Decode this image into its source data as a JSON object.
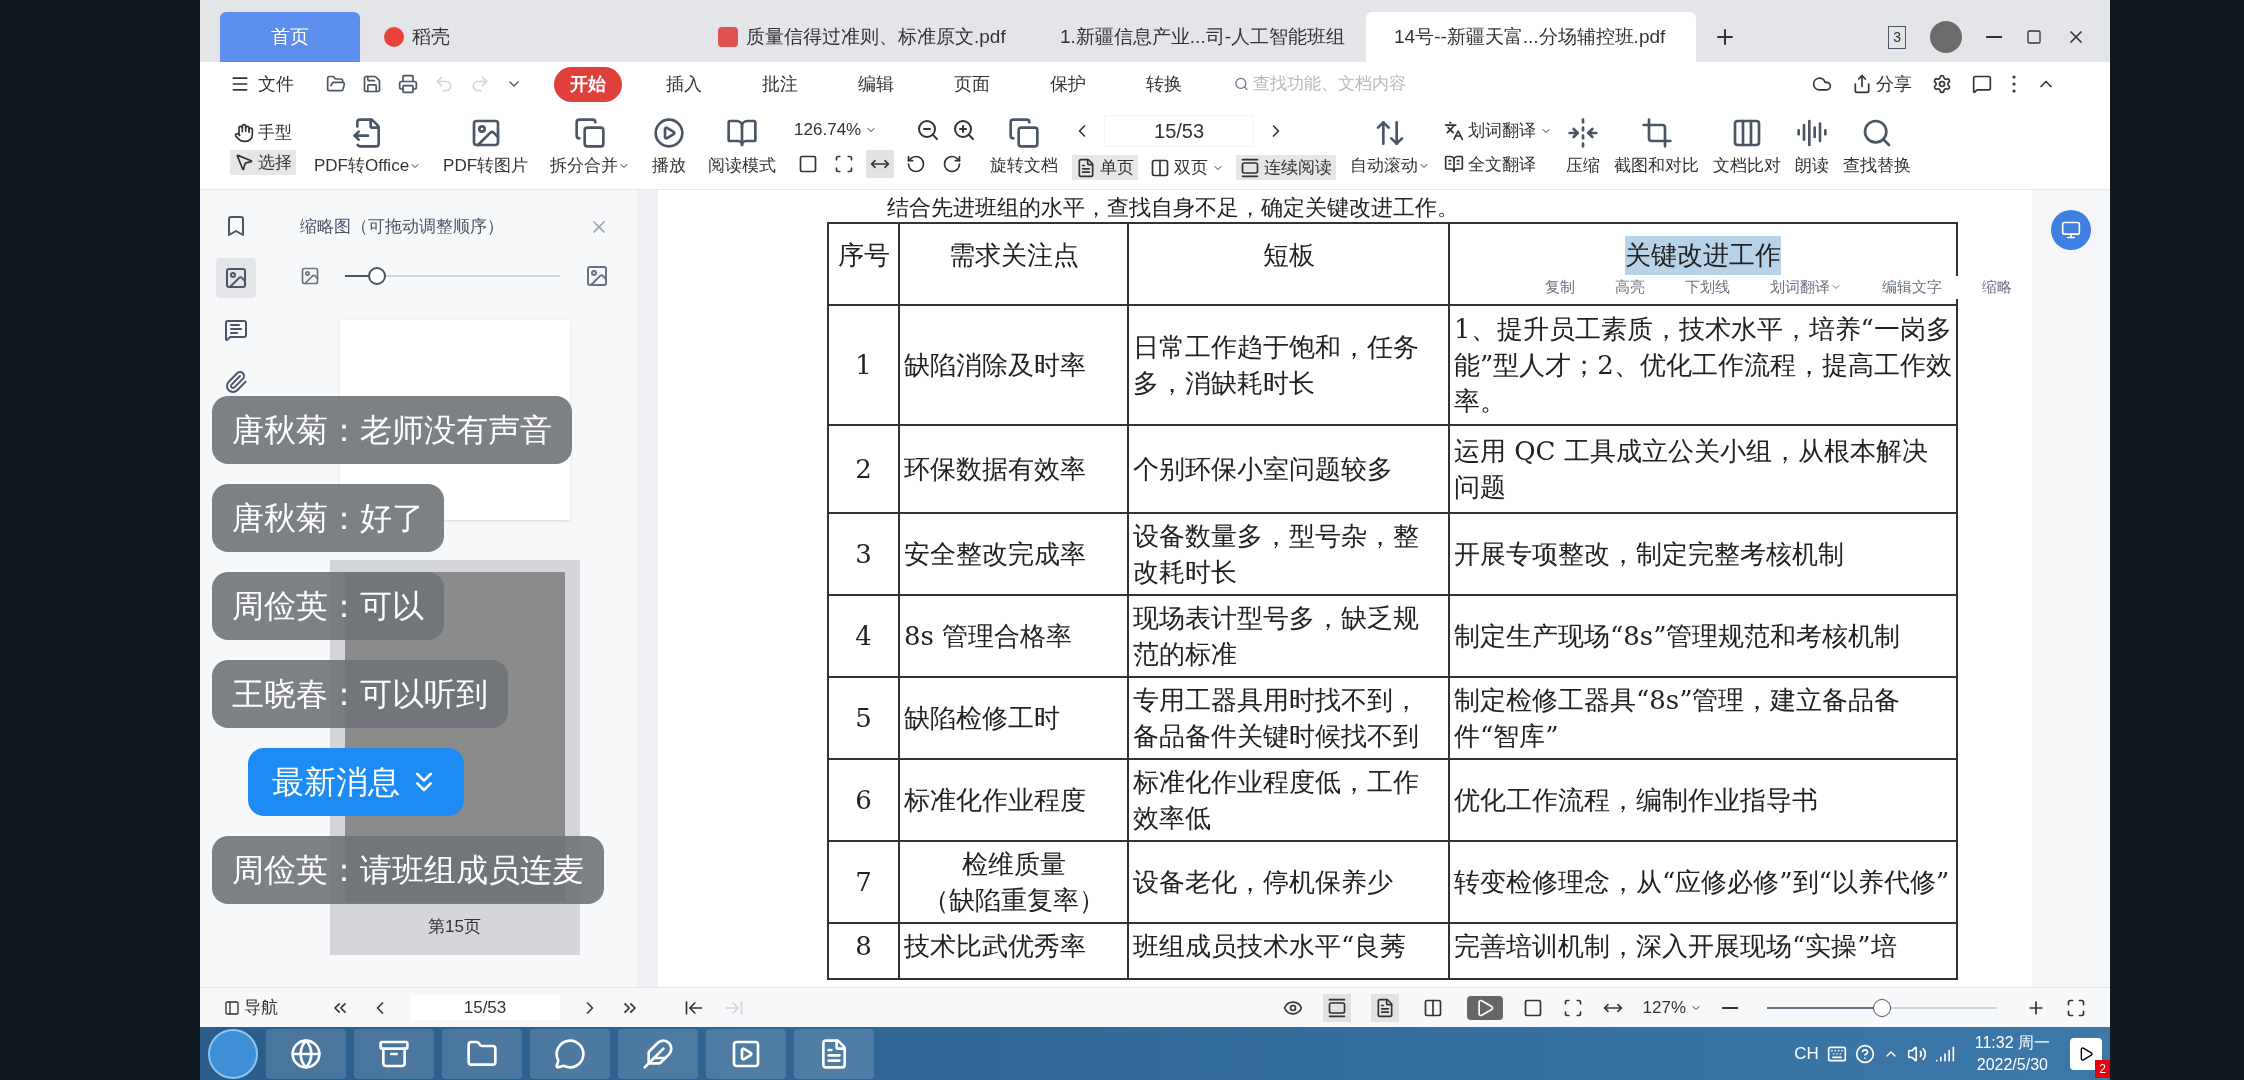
{
  "tabs": [
    {
      "label": "首页",
      "kind": "home",
      "selected": false
    },
    {
      "label": "稻壳",
      "kind": "docer",
      "selected": false
    },
    {
      "label": "质量信得过准则、标准原文.pdf",
      "kind": "pdf",
      "selected": false
    },
    {
      "label": "1.新疆信息产业...司-人工智能班组",
      "kind": "word",
      "selected": false
    },
    {
      "label": "14号--新疆天富...分场辅控班.pdf",
      "kind": "pdf",
      "selected": true
    }
  ],
  "window_badge": "3",
  "menu": {
    "file": "文件",
    "items": [
      {
        "label": "开始",
        "selected": true
      },
      {
        "label": "插入",
        "selected": false
      },
      {
        "label": "批注",
        "selected": false
      },
      {
        "label": "编辑",
        "selected": false
      },
      {
        "label": "页面",
        "selected": false
      },
      {
        "label": "保护",
        "selected": false
      },
      {
        "label": "转换",
        "selected": false
      }
    ],
    "search_placeholder": "查找功能、文档内容",
    "share": "分享"
  },
  "toolbar": {
    "pointer_modes": [
      {
        "label": "手型",
        "kind": "hand",
        "selected": false
      },
      {
        "label": "选择",
        "kind": "select",
        "selected": true
      }
    ],
    "tools": [
      {
        "label": "PDF转Office",
        "kind": "convert",
        "dropdown": true
      },
      {
        "label": "PDF转图片",
        "kind": "image",
        "dropdown": false
      },
      {
        "label": "拆分合并",
        "kind": "split",
        "dropdown": true
      },
      {
        "label": "播放",
        "kind": "play",
        "dropdown": false
      },
      {
        "label": "阅读模式",
        "kind": "read",
        "dropdown": false
      }
    ],
    "zoom": "126.74%",
    "fit_modes": [
      {
        "kind": "actual",
        "selected": false
      },
      {
        "kind": "fit",
        "selected": false
      },
      {
        "kind": "width",
        "selected": true
      },
      {
        "kind": "rotl",
        "selected": false
      },
      {
        "kind": "rotr",
        "selected": false
      }
    ],
    "rotate": "旋转文档",
    "page": "15/53",
    "view_modes": [
      {
        "label": "单页",
        "kind": "single",
        "selected": true,
        "dropdown": false
      },
      {
        "label": "双页",
        "kind": "double",
        "selected": false,
        "dropdown": true
      },
      {
        "label": "连续阅读",
        "kind": "continuous",
        "selected": true,
        "dropdown": false
      }
    ],
    "auto_scroll": "自动滚动",
    "translate": "划词翻译",
    "full_translate": "全文翻译",
    "tools2": [
      {
        "label": "压缩",
        "kind": "compress"
      },
      {
        "label": "截图和对比",
        "kind": "screenshot"
      },
      {
        "label": "文档比对",
        "kind": "compare"
      },
      {
        "label": "朗读",
        "kind": "read_aloud"
      },
      {
        "label": "查找替换",
        "kind": "find"
      }
    ]
  },
  "sidebar": {
    "title": "缩略图（可拖动调整顺序）",
    "level": 0.15,
    "icons": [
      {
        "kind": "bookmark",
        "selected": false
      },
      {
        "kind": "thumbnail",
        "selected": true
      },
      {
        "kind": "comment",
        "selected": false
      },
      {
        "kind": "attachment",
        "selected": false
      }
    ],
    "pages": [
      {
        "label": "第15页",
        "selected": true
      }
    ]
  },
  "chat": {
    "messages": [
      {
        "text": "唐秋菊：老师没有声音"
      },
      {
        "text": "唐秋菊：好了"
      },
      {
        "text": "周俭英：可以"
      },
      {
        "text": "王晓春：可以听到"
      },
      {
        "text": "周俭英：请班组成员连麦"
      }
    ],
    "latest_button": "最新消息"
  },
  "document": {
    "intro": "结合先进班组的水平，查找自身不足，确定关键改进工作。",
    "columns": [
      {
        "label": "序号",
        "selected": false
      },
      {
        "label": "需求关注点",
        "selected": false
      },
      {
        "label": "短板",
        "selected": false
      },
      {
        "label": "关键改进工作",
        "selected": true
      }
    ],
    "popup": [
      {
        "label": "复制",
        "dropdown": false
      },
      {
        "label": "高亮",
        "dropdown": false
      },
      {
        "label": "下划线",
        "dropdown": false
      },
      {
        "label": "划词翻译",
        "dropdown": true
      },
      {
        "label": "编辑文字",
        "dropdown": false
      },
      {
        "label": "缩略",
        "dropdown": false
      }
    ],
    "rows": [
      [
        "1",
        "缺陷消除及时率",
        "日常工作趋于饱和，任务多，消缺耗时长",
        "1、提升员工素质，技术水平，培养“一岗多能”型人才；2、优化工作流程，提高工作效率。"
      ],
      [
        "2",
        "环保数据有效率",
        "个别环保小室问题较多",
        "运用 QC 工具成立公关小组，从根本解决问题"
      ],
      [
        "3",
        "安全整改完成率",
        "设备数量多，型号杂，整改耗时长",
        "开展专项整改，制定完整考核机制"
      ],
      [
        "4",
        "8s 管理合格率",
        "现场表计型号多，缺乏规范的标准",
        "制定生产现场“8s”管理规范和考核机制"
      ],
      [
        "5",
        "缺陷检修工时",
        "专用工器具用时找不到，备品备件关键时候找不到",
        "制定检修工器具“8s”管理，建立备品备件“智库”"
      ],
      [
        "6",
        "标准化作业程度",
        "标准化作业程度低，工作效率低",
        "优化工作流程，编制作业指导书"
      ],
      [
        "7",
        [
          "检维质量",
          "（缺陷重复率）"
        ],
        "设备老化，停机保养少",
        "转变检修理念，从“应修必修”到“以养代修”"
      ],
      [
        "8",
        "技术比武优秀率",
        "班组成员技术水平“良莠",
        "完善培训机制，深入开展现场“实操”培"
      ]
    ]
  },
  "bottom_bar": {
    "nav": "导航",
    "page": "15/53",
    "view_buttons": [
      {
        "kind": "continuous",
        "selected": true
      },
      {
        "kind": "single",
        "selected": true
      },
      {
        "kind": "double",
        "selected": false
      }
    ],
    "zoom": "127%",
    "level": 0.5
  },
  "taskbar": {
    "apps": [
      {
        "kind": "ie"
      },
      {
        "kind": "archive"
      },
      {
        "kind": "folder"
      },
      {
        "kind": "chat"
      },
      {
        "kind": "feather"
      },
      {
        "kind": "video"
      },
      {
        "kind": "wps"
      }
    ],
    "language": "CH",
    "time": "11:32 周一",
    "date": "2022/5/30",
    "notifications": "2"
  }
}
